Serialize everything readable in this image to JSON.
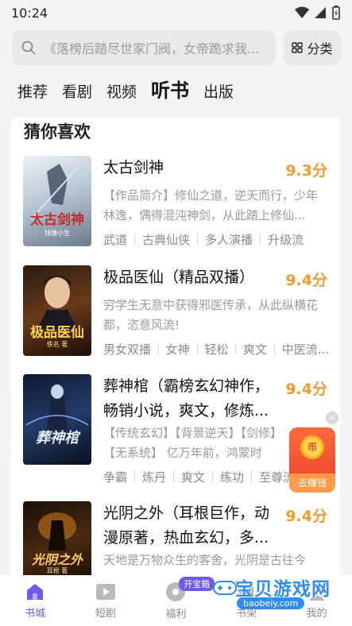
{
  "status_bar": {
    "time": "10:24"
  },
  "search": {
    "placeholder": "《落榜后踏尽世家门阀，女帝跪求我...",
    "category_label": "分类"
  },
  "tabs": [
    {
      "label": "推荐",
      "active": false
    },
    {
      "label": "看剧",
      "active": false
    },
    {
      "label": "视频",
      "active": false
    },
    {
      "label": "听书",
      "active": true
    },
    {
      "label": "出版",
      "active": false
    }
  ],
  "section": {
    "title": "猜你喜欢"
  },
  "books": [
    {
      "title": "太古剑神",
      "score": "9.3分",
      "desc": "【作品简介】修仙之道，逆天而行，少年林逸，偶得混沌神剑，从此踏上修仙...",
      "tags": [
        "武道",
        "古典仙侠",
        "多人演播",
        "升级流"
      ],
      "cover_text": "太古剑神",
      "cover_sub": "钱塘小生"
    },
    {
      "title": "极品医仙（精品双播）",
      "score": "9.4分",
      "desc": "穷学生无意中获得邪医传承，从此纵横花都，恣意风流!",
      "tags": [
        "男女双播",
        "女神",
        "轻松",
        "爽文",
        "中医流..."
      ],
      "cover_text": "极品医仙",
      "cover_sub": "佚名 著"
    },
    {
      "title": "葬神棺（霸榜玄幻神作，畅销小说，爽文，修炼...",
      "score": "9.4分",
      "desc": "【传统玄幻】【背景逆天】【剑修】【无系统】 亿万年前，鸿蒙时代，...",
      "tags": [
        "争霸",
        "炼丹",
        "爽文",
        "练功",
        "至尊流"
      ],
      "cover_text": "葬神棺",
      "cover_sub": ""
    },
    {
      "title": "光阴之外（耳根巨作，动漫原著，热血玄幻，多...",
      "score": "9.4分",
      "desc": "天地是万物众生的客舍，光阴是古往今来...",
      "tags": [],
      "cover_text": "光阴之外",
      "cover_sub": "耳根 著"
    }
  ],
  "float_ad": {
    "coin": "币",
    "label": "去赚钱"
  },
  "bottom_nav": [
    {
      "label": "书城",
      "icon": "home-icon",
      "active": true
    },
    {
      "label": "短剧",
      "icon": "play-icon",
      "active": false
    },
    {
      "label": "福利",
      "icon": "gift-icon",
      "active": false,
      "badge": "开宝箱"
    },
    {
      "label": "书架",
      "icon": "bookshelf-icon",
      "active": false
    },
    {
      "label": "我的",
      "icon": "user-icon",
      "active": false
    }
  ],
  "watermark": {
    "title": "宝贝游戏网",
    "url": "baobeiy.com"
  },
  "colors": {
    "accent": "#6c5ce7",
    "score": "#f29a2e",
    "float": "#e8412a"
  }
}
